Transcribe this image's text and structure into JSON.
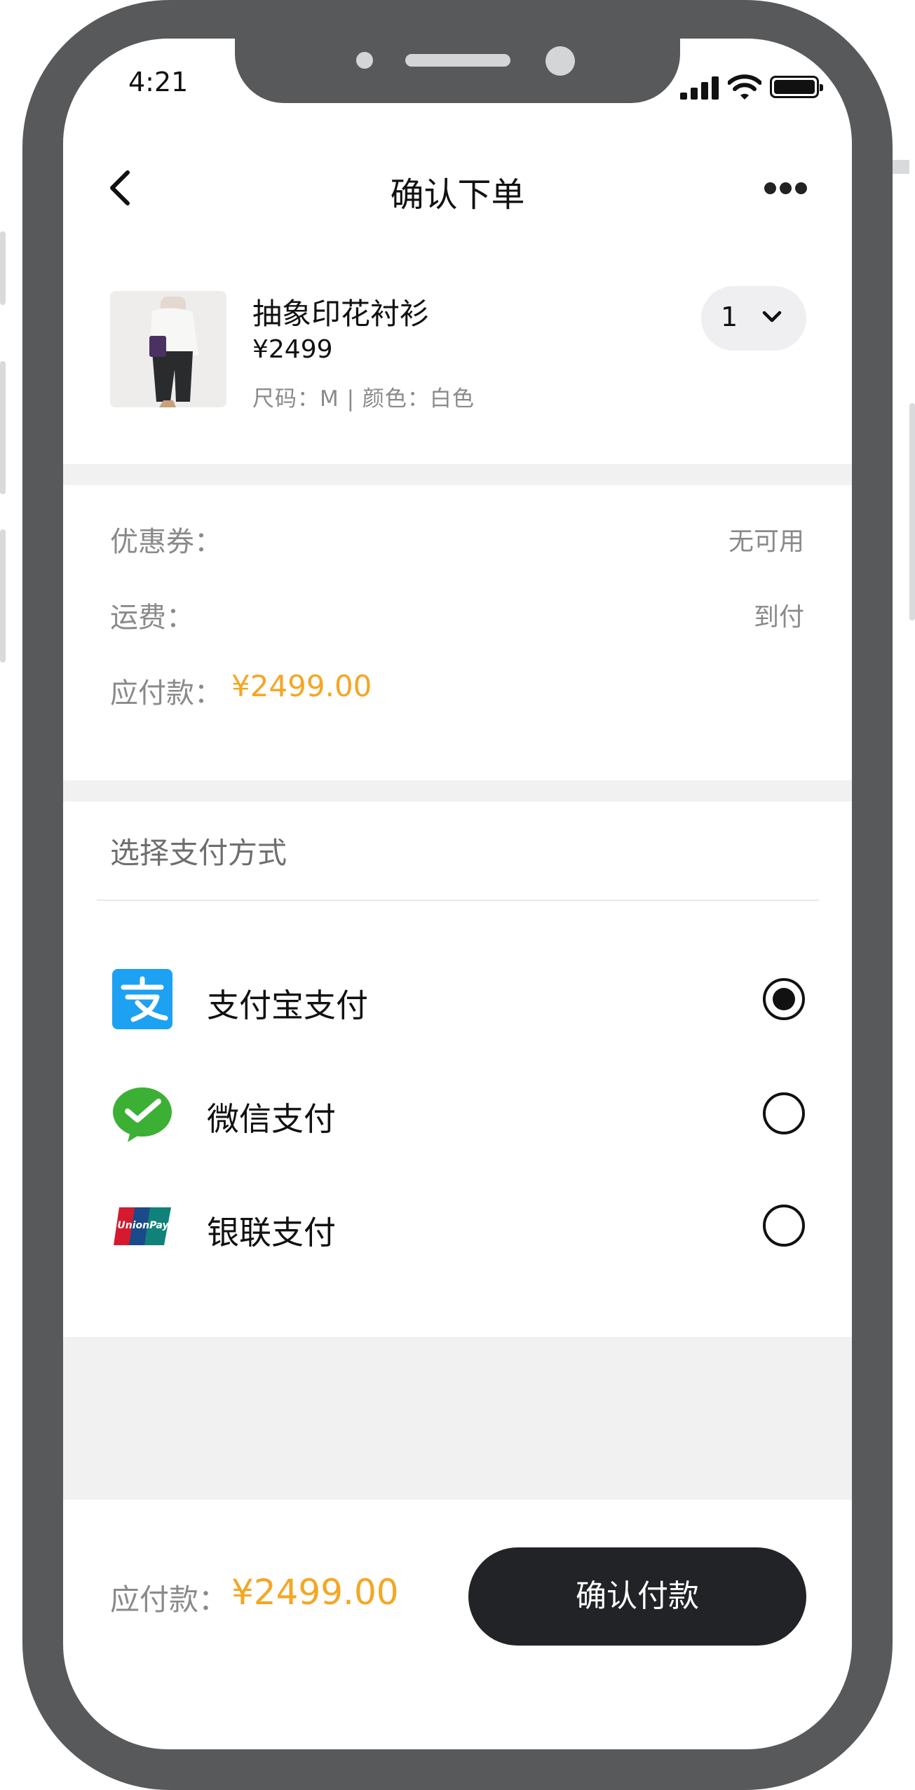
{
  "status_bar": {
    "time": "4:21"
  },
  "nav": {
    "title": "确认下单"
  },
  "product": {
    "name": "抽象印花衬衫",
    "price": "¥2499",
    "spec": "尺码：M | 颜色：白色",
    "quantity": "1"
  },
  "summary": {
    "coupon_label": "优惠券：",
    "coupon_value": "无可用",
    "shipping_label": "运费：",
    "shipping_value": "到付",
    "due_label": "应付款：",
    "due_amount": "¥2499.00"
  },
  "payment": {
    "title": "选择支付方式",
    "selected": "alipay",
    "methods": [
      {
        "id": "alipay",
        "label": "支付宝支付",
        "icon": "alipay-icon",
        "color": "#1da1f2"
      },
      {
        "id": "wechat",
        "label": "微信支付",
        "icon": "wechat-pay-icon",
        "color": "#3cb034"
      },
      {
        "id": "unionpay",
        "label": "银联支付",
        "icon": "unionpay-icon",
        "color": "#d51a2f"
      }
    ]
  },
  "footer": {
    "due_label": "应付款：",
    "due_amount": "¥2499.00",
    "confirm_label": "确认付款"
  },
  "colors": {
    "accent": "#f5a623",
    "button": "#222326",
    "frame": "#58595b"
  }
}
